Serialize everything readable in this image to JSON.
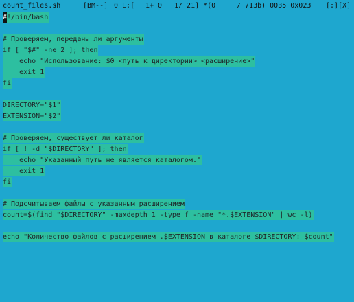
{
  "status": {
    "filename": "count_files.sh",
    "mode": "[BM--]",
    "col": "0 L:[",
    "pos": "1+ 0",
    "lines": "1/ 21] *(0",
    "size": "/ 713b) 0035 0x023",
    "flags": "[:][X]"
  },
  "code": {
    "lines": [
      "#!/bin/bash",
      "",
      "# Проверяем, переданы ли аргументы",
      "if [ \"$#\" -ne 2 ]; then",
      "    echo \"Использование: $0 <путь к директории> <расширение>\"",
      "    exit 1",
      "fi",
      "",
      "DIRECTORY=\"$1\"",
      "EXTENSION=\"$2\"",
      "",
      "# Проверяем, существует ли каталог",
      "if [ ! -d \"$DIRECTORY\" ]; then",
      "    echo \"Указанный путь не является каталогом.\"",
      "    exit 1",
      "fi",
      "",
      "# Подсчитываем файлы с указанным расширением",
      "count=$(find \"$DIRECTORY\" -maxdepth 1 -type f -name \"*.$EXTENSION\" | wc -l)",
      "",
      "echo \"Количество файлов с расширением .$EXTENSION в каталоге $DIRECTORY: $count\""
    ]
  },
  "cursor": {
    "char": "#"
  },
  "colors": {
    "background": "#1ea7cf",
    "selection": "#2dbfa0",
    "text": "#1f2428"
  }
}
